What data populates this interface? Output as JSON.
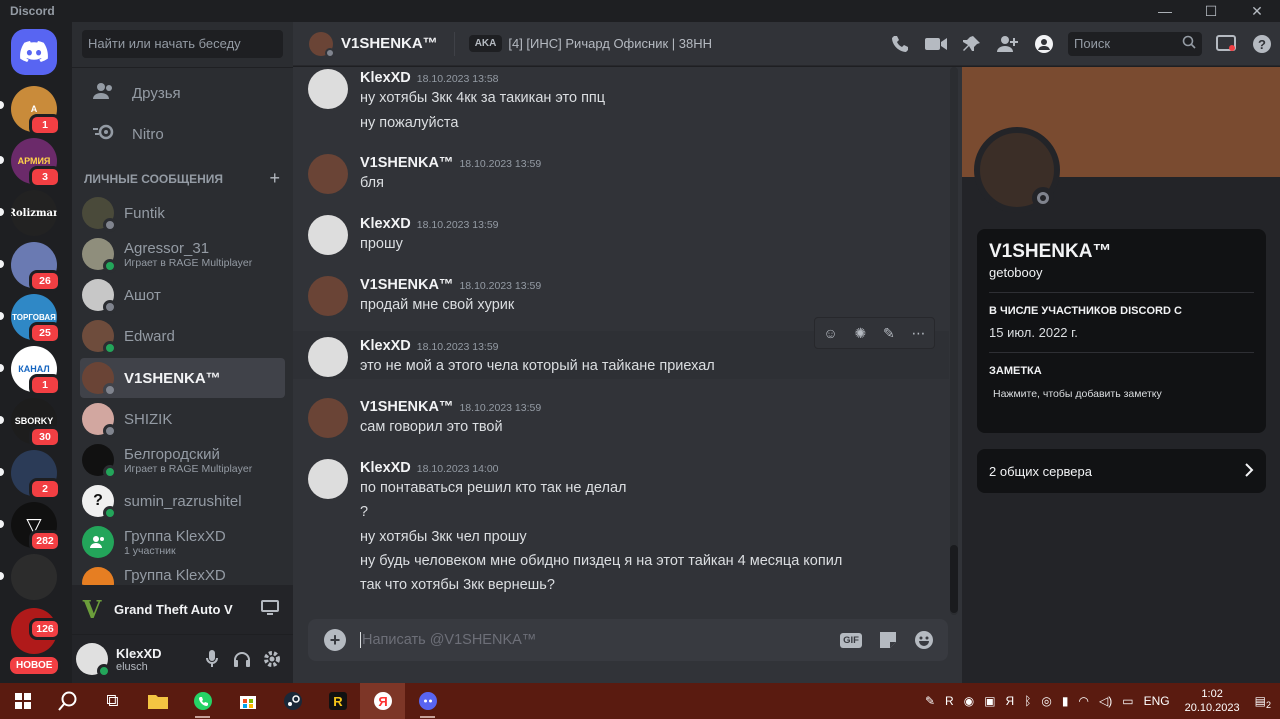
{
  "window": {
    "title": "Discord"
  },
  "servers": [
    {
      "label": "A",
      "badge": "1",
      "bg": "#c98b3a"
    },
    {
      "label": "АРМИЯ",
      "badge": "3",
      "bg": "#6b2a6a"
    },
    {
      "label": "Rolizman",
      "badge": "",
      "bg": "#222222"
    },
    {
      "label": "",
      "badge": "26",
      "bg": "#6a7ab2"
    },
    {
      "label": "ТОРГОВАЯ",
      "badge": "25",
      "bg": "#2f88c6"
    },
    {
      "label": "КАНАЛ",
      "badge": "1",
      "bg": "#1565c0"
    },
    {
      "label": "SBORKY",
      "badge": "30",
      "bg": "#1d1d1d"
    },
    {
      "label": "",
      "badge": "2",
      "bg": "#2b3b57"
    },
    {
      "label": "",
      "badge": "282",
      "bg": "#101010"
    },
    {
      "label": "",
      "badge": "",
      "bg": "#2c2c2c"
    },
    {
      "label": "",
      "badge": "126",
      "bg": "#b01a1a"
    }
  ],
  "new_label": "НОВОЕ",
  "sidebar": {
    "search_placeholder": "Найти или начать беседу",
    "friends": "Друзья",
    "nitro": "Nitro",
    "dm_header": "ЛИЧНЫЕ СООБЩЕНИЯ",
    "dms": [
      {
        "name": "Funtik",
        "sub": "",
        "status": "off",
        "bg": "#4a4a3a"
      },
      {
        "name": "Agressor_31",
        "sub": "Играет в RAGE Multiplayer",
        "status": "on",
        "bg": "#8f8e7c"
      },
      {
        "name": "Ашот",
        "sub": "",
        "status": "off",
        "bg": "#c7c7c7"
      },
      {
        "name": "Edward",
        "sub": "",
        "status": "on",
        "bg": "#6e4c3c"
      },
      {
        "name": "V1SHENKA™",
        "sub": "",
        "status": "off",
        "bg": "#6a4436"
      },
      {
        "name": "SHIZIK",
        "sub": "",
        "status": "off",
        "bg": "#d2a7a0"
      },
      {
        "name": "Белгородский",
        "sub": "Играет в RAGE Multiplayer",
        "status": "on",
        "bg": "#111111"
      },
      {
        "name": "sumin_razrushitel",
        "sub": "",
        "status": "on",
        "bg": "#f0f0f0"
      },
      {
        "name": "Группа KlexXD",
        "sub": "1 участник",
        "status": "",
        "bg": "#23a55a"
      },
      {
        "name": "Группа KlexXD",
        "sub": "",
        "status": "",
        "bg": "#e67e22"
      }
    ],
    "activity": "Grand Theft Auto V",
    "user": {
      "name": "KlexXD",
      "tag": "elusch"
    }
  },
  "chat_header": {
    "name": "V1SHENKA™",
    "aka": "AKA",
    "nicks": "[4] [ИНС] Ричард Офисник | 38НН",
    "search_placeholder": "Поиск"
  },
  "messages": [
    {
      "author": "KlexXD",
      "time": "18.10.2023 13:58",
      "lines": [
        "ну хотябы 3кк 4кк за такикан это ппц",
        "ну пожалуйста"
      ]
    },
    {
      "author": "V1SHENKA™",
      "time": "18.10.2023 13:59",
      "lines": [
        "бля"
      ]
    },
    {
      "author": "KlexXD",
      "time": "18.10.2023 13:59",
      "lines": [
        "прошу"
      ]
    },
    {
      "author": "V1SHENKA™",
      "time": "18.10.2023 13:59",
      "lines": [
        "продай мне свой хурик"
      ]
    },
    {
      "author": "KlexXD",
      "time": "18.10.2023 13:59",
      "lines": [
        "это не мой а этого чела который на тайкане приехал"
      ]
    },
    {
      "author": "V1SHENKA™",
      "time": "18.10.2023 13:59",
      "lines": [
        "сам говорил это твой"
      ]
    },
    {
      "author": "KlexXD",
      "time": "18.10.2023 14:00",
      "lines": [
        "по понтаваться решил кто так не делал",
        "?",
        "ну хотябы 3кк чел прошу",
        "ну будь человеком мне обидно пиздец я на этот тайкан 4 месяца копил",
        "так что хотябы 3кк вернешь?"
      ]
    }
  ],
  "composer": {
    "placeholder": "Написать @V1SHENKA™",
    "gif": "GIF"
  },
  "profile": {
    "display_name": "V1SHENKA™",
    "username": "getobooy",
    "member_since_label": "В ЧИСЛЕ УЧАСТНИКОВ DISCORD С",
    "member_since": "15 июл. 2022 г.",
    "note_label": "ЗАМЕТКА",
    "note_placeholder": "Нажмите, чтобы добавить заметку",
    "mutual_servers": "2 общих сервера"
  },
  "taskbar": {
    "lang": "ENG",
    "time": "1:02",
    "date": "20.10.2023",
    "notif_count": "2"
  }
}
